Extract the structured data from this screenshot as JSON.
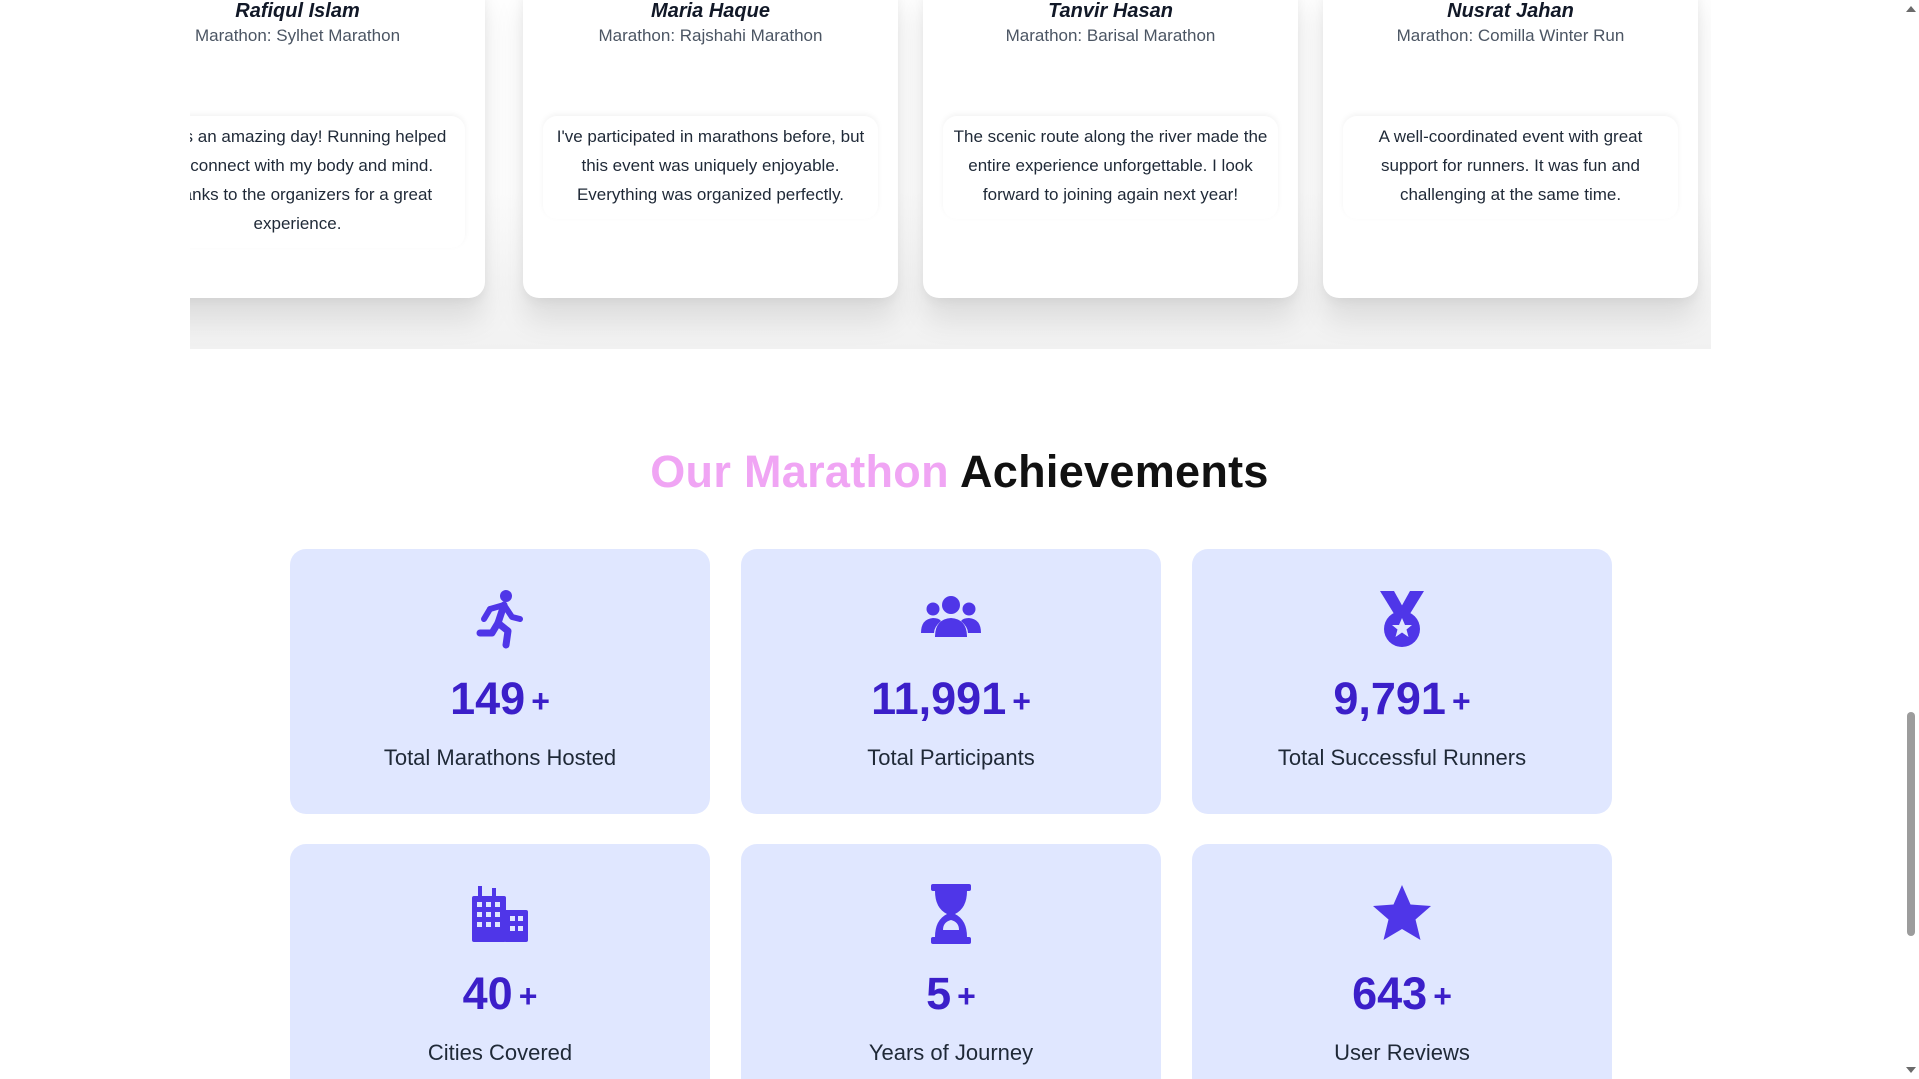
{
  "testimonials": [
    {
      "name": "Rafiqul Islam",
      "event": "Marathon: Sylhet Marathon",
      "quote": "It was an amazing day! Running helped me connect with my body and mind. Thanks to the organizers for a great experience."
    },
    {
      "name": "Maria Haque",
      "event": "Marathon: Rajshahi Marathon",
      "quote": "I've participated in marathons before, but this event was uniquely enjoyable. Everything was organized perfectly."
    },
    {
      "name": "Tanvir Hasan",
      "event": "Marathon: Barisal Marathon",
      "quote": "The scenic route along the river made the entire experience unforgettable. I look forward to joining again next year!"
    },
    {
      "name": "Nusrat Jahan",
      "event": "Marathon: Comilla Winter Run",
      "quote": "A well-coordinated event with great support for runners. It was fun and challenging at the same time."
    }
  ],
  "achievements": {
    "title_accent": "Our Marathon",
    "title_rest": "Achievements",
    "stats": [
      {
        "icon": "runner-icon",
        "value": "149",
        "suffix": "+",
        "label": "Total Marathons Hosted"
      },
      {
        "icon": "users-group-icon",
        "value": "11,991",
        "suffix": "+",
        "label": "Total Participants"
      },
      {
        "icon": "medal-icon",
        "value": "9,791",
        "suffix": "+",
        "label": "Total Successful Runners"
      },
      {
        "icon": "city-icon",
        "value": "40",
        "suffix": "+",
        "label": "Cities Covered"
      },
      {
        "icon": "hourglass-icon",
        "value": "5",
        "suffix": "+",
        "label": "Years of Journey"
      },
      {
        "icon": "star-icon",
        "value": "643",
        "suffix": "+",
        "label": "User Reviews"
      }
    ]
  },
  "colors": {
    "accent_pink": "#f0a5f4",
    "stat_number": "#3b1fc9",
    "stat_icon": "#4f36e8",
    "stat_card_bg": "#e0e7ff"
  }
}
